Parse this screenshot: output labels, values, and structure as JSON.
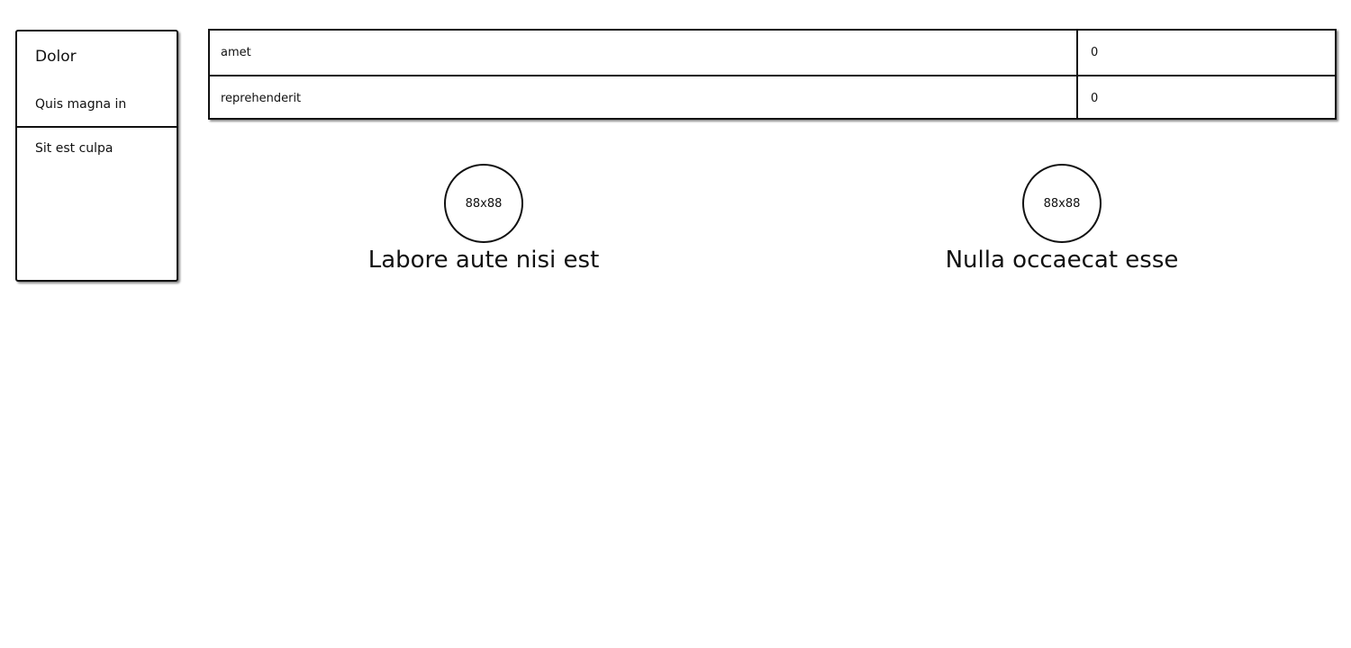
{
  "sidebar": {
    "title": "Dolor",
    "subtitle": "Quis magna in",
    "items": [
      {
        "label": "Sit est culpa"
      }
    ]
  },
  "table": {
    "rows": [
      {
        "label": "amet",
        "value": "0"
      },
      {
        "label": "reprehenderit",
        "value": "0"
      }
    ]
  },
  "profiles": [
    {
      "avatar_text": "88x88",
      "name": "Labore aute nisi est"
    },
    {
      "avatar_text": "88x88",
      "name": "Nulla occaecat esse"
    }
  ]
}
